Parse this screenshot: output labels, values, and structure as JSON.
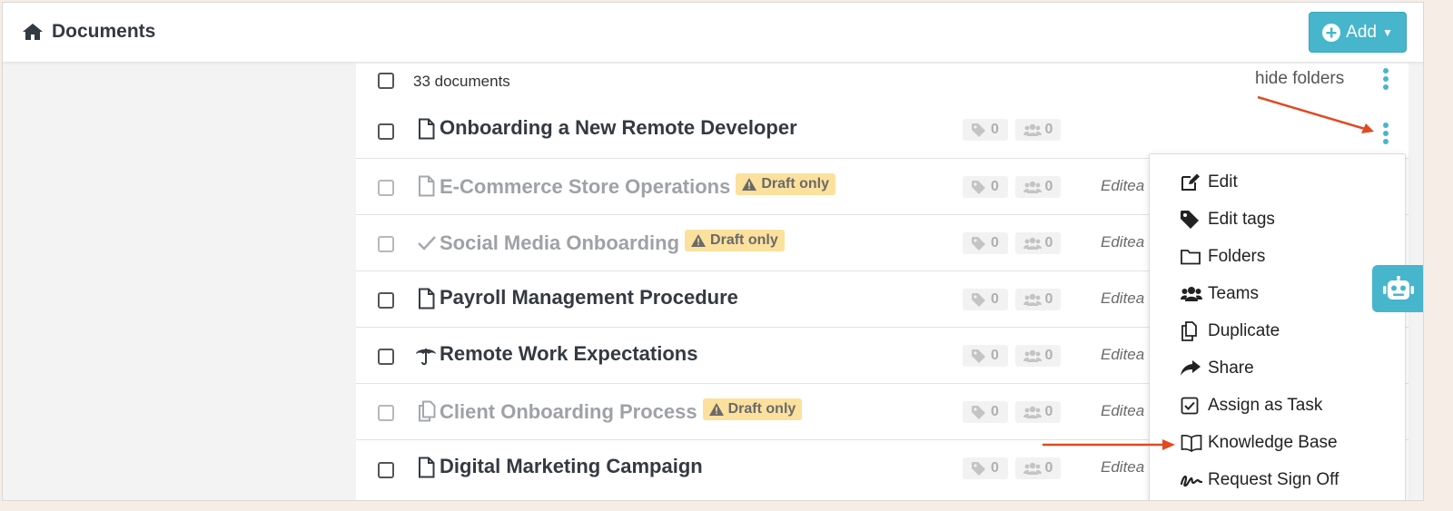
{
  "header": {
    "title": "Documents",
    "add_label": "Add",
    "home_icon": "home-icon",
    "accent": "#47b6cc"
  },
  "list": {
    "count_label": "33 documents",
    "hide_folders_label": "hide folders",
    "rows": [
      {
        "name": "Onboarding a New Remote Developer",
        "icon": "file-icon",
        "draft": false,
        "tags": "0",
        "teams": "0",
        "edited": ""
      },
      {
        "name": "E-Commerce Store Operations",
        "icon": "file-icon",
        "draft": true,
        "tags": "0",
        "teams": "0",
        "edited": "Editea"
      },
      {
        "name": "Social Media Onboarding",
        "icon": "check-icon",
        "draft": true,
        "tags": "0",
        "teams": "0",
        "edited": "Editea"
      },
      {
        "name": "Payroll Management Procedure",
        "icon": "file-icon",
        "draft": false,
        "tags": "0",
        "teams": "0",
        "edited": "Editea"
      },
      {
        "name": "Remote Work Expectations",
        "icon": "umbrella-icon",
        "draft": false,
        "tags": "0",
        "teams": "0",
        "edited": "Editea"
      },
      {
        "name": "Client Onboarding Process",
        "icon": "copy-icon",
        "draft": true,
        "tags": "0",
        "teams": "0",
        "edited": "Editea"
      },
      {
        "name": "Digital Marketing Campaign",
        "icon": "file-icon",
        "draft": false,
        "tags": "0",
        "teams": "0",
        "edited": "Editea"
      }
    ],
    "draft_label": "Draft only"
  },
  "menu": {
    "items": [
      {
        "label": "Edit",
        "icon": "edit-icon"
      },
      {
        "label": "Edit tags",
        "icon": "tag-icon"
      },
      {
        "label": "Folders",
        "icon": "folder-icon"
      },
      {
        "label": "Teams",
        "icon": "users-icon"
      },
      {
        "label": "Duplicate",
        "icon": "copy-icon"
      },
      {
        "label": "Share",
        "icon": "share-icon"
      },
      {
        "label": "Assign as Task",
        "icon": "checkbox-icon"
      },
      {
        "label": "Knowledge Base",
        "icon": "book-icon"
      },
      {
        "label": "Request Sign Off",
        "icon": "signature-icon"
      }
    ]
  },
  "annotations": {
    "arrow_color": "#e04a23"
  }
}
